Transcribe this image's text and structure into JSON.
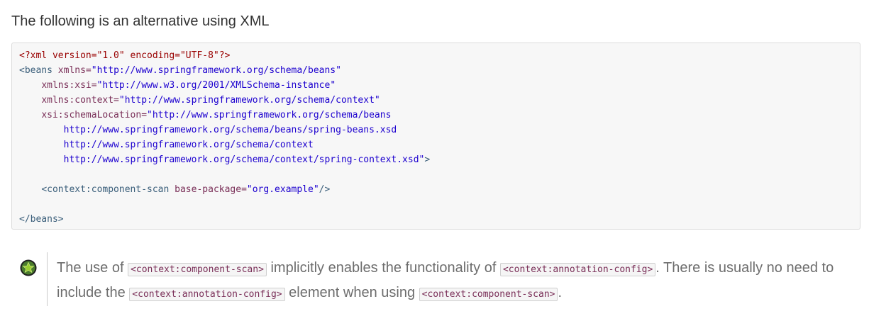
{
  "intro_text": "The following is an alternative using XML",
  "code": {
    "xml_decl": "<?xml version=\"1.0\" encoding=\"UTF-8\"?>",
    "beans_open": "<beans",
    "attr_xmlns": "xmlns=",
    "val_xmlns": "\"http://www.springframework.org/schema/beans\"",
    "attr_xsi": "xmlns:xsi=",
    "val_xsi": "\"http://www.w3.org/2001/XMLSchema-instance\"",
    "attr_context": "xmlns:context=",
    "val_context": "\"http://www.springframework.org/schema/context\"",
    "attr_schema": "xsi:schemaLocation=",
    "val_schema_1": "\"http://www.springframework.org/schema/beans",
    "val_schema_2": "http://www.springframework.org/schema/beans/spring-beans.xsd",
    "val_schema_3": "http://www.springframework.org/schema/context",
    "val_schema_4": "http://www.springframework.org/schema/context/spring-context.xsd\"",
    "open_end": ">",
    "scan_open": "<context:component-scan",
    "attr_base": "base-package=",
    "val_base": "\"org.example\"",
    "self_close": "/>",
    "beans_close": "</beans>"
  },
  "note": {
    "icon": "star-tip-icon",
    "icon_color": "#4a7c2c",
    "part1": "The use of ",
    "code1": "<context:component-scan>",
    "part2": " implicitly enables the functionality of ",
    "code2": "<context:annotation-config>",
    "part3": ". There is usually no need to include the ",
    "code3": "<context:annotation-config>",
    "part4": " element when using ",
    "code4": "<context:component-scan>",
    "part5": "."
  }
}
